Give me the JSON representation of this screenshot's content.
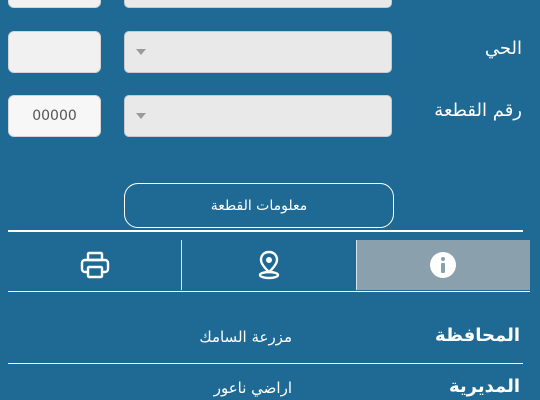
{
  "form": {
    "district_label": "الحي",
    "plot_number_label": "رقم القطعة",
    "plot_number_value": "00000",
    "plot_info_button": "معلومات القطعة"
  },
  "tabs": [
    {
      "icon": "printer-icon"
    },
    {
      "icon": "map-pin-icon"
    },
    {
      "icon": "info-icon",
      "active": true
    }
  ],
  "details": [
    {
      "label": "المحافظة",
      "value": "مزرعة السامك"
    },
    {
      "label": "المديرية",
      "value": "اراضي ناعور"
    }
  ],
  "colors": {
    "background": "#1f6a94",
    "active_tab": "#8aa0ad",
    "field": "#e9e9e9"
  }
}
